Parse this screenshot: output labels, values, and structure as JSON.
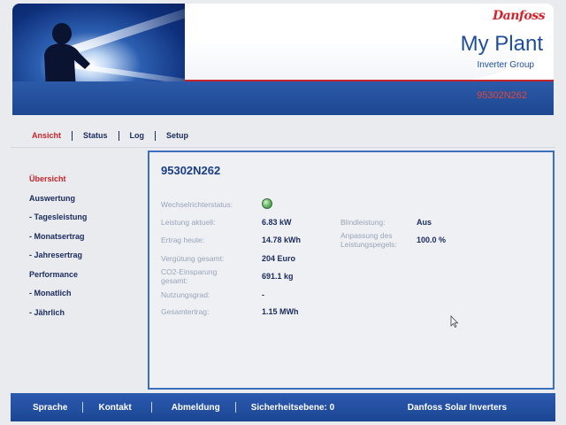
{
  "header": {
    "logo_text": "Danfoss",
    "title": "My Plant",
    "subtitle": "Inverter Group",
    "serial": "95302N262",
    "accent_color": "#c7242a",
    "brand_blue": "#1e4e9b"
  },
  "topnav": {
    "items": [
      {
        "label": "Ansicht",
        "active": true
      },
      {
        "label": "Status"
      },
      {
        "label": "Log"
      },
      {
        "label": "Setup"
      }
    ]
  },
  "sidebar": {
    "items": [
      {
        "label": "Übersicht",
        "active": true
      },
      {
        "label": "Auswertung"
      },
      {
        "label": "- Tagesleistung"
      },
      {
        "label": "- Monatsertrag"
      },
      {
        "label": "- Jahresertrag"
      },
      {
        "label": "Performance"
      },
      {
        "label": "- Monatlich"
      },
      {
        "label": "- Jährlich"
      }
    ]
  },
  "panel": {
    "title": "95302N262",
    "status_label": "Wechselrichterstatus:",
    "status_icon": "status-ok-icon",
    "fields_left": [
      {
        "label": "Leistung aktuell:",
        "value": "6.83 kW"
      },
      {
        "label": "Ertrag heute:",
        "value": "14.78 kWh"
      },
      {
        "label": "Vergütung gesamt:",
        "value": "204 Euro"
      },
      {
        "label": "CO2-Einsparung gesamt:",
        "value": "691.1 kg"
      },
      {
        "label": "Nutzungsgrad:",
        "value": "-"
      },
      {
        "label": "Gesamtertrag:",
        "value": "1.15 MWh"
      }
    ],
    "fields_right": [
      {
        "label": "Blindleistung:",
        "value": "Aus"
      },
      {
        "label": "Anpassung des Leistungspegels:",
        "value": "100.0 %"
      }
    ]
  },
  "footer": {
    "sprache": "Sprache",
    "kontakt": "Kontakt",
    "abmeldung": "Abmeldung",
    "sicherheitsebene": "Sicherheitsebene: 0",
    "brand": "Danfoss Solar Inverters"
  }
}
